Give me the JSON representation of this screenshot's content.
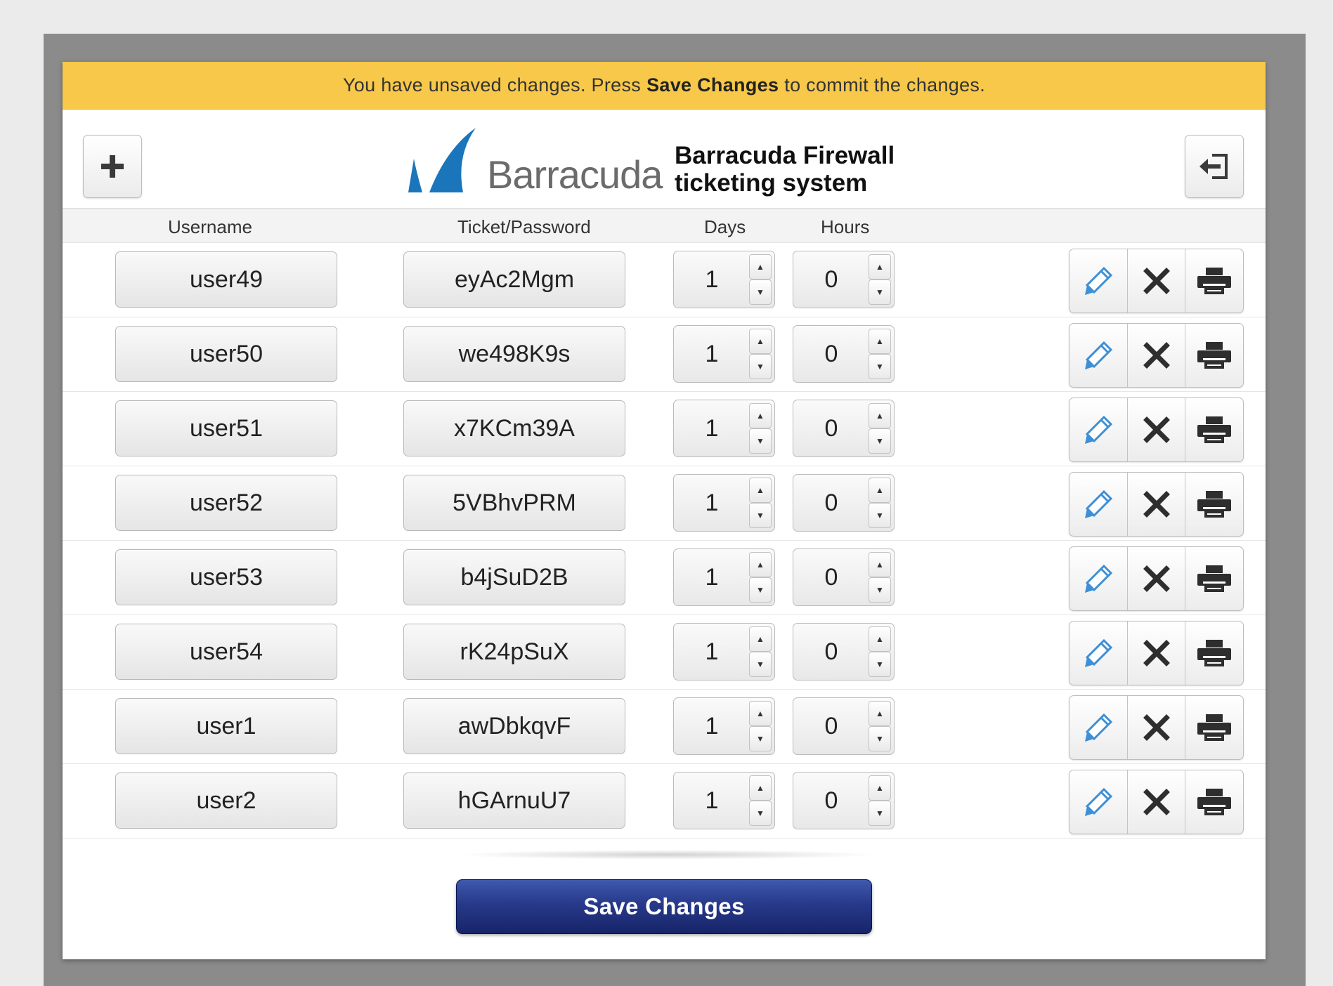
{
  "banner": {
    "prefix": "You have unsaved changes. Press",
    "emphasis": "Save Changes",
    "suffix": "to commit the changes."
  },
  "header": {
    "logo_word": "Barracuda",
    "title_line1": "Barracuda Firewall",
    "title_line2": "ticketing system",
    "add_icon": "plus-icon",
    "logout_icon": "logout-icon"
  },
  "columns": {
    "username": "Username",
    "ticket": "Ticket/Password",
    "days": "Days",
    "hours": "Hours"
  },
  "rows": [
    {
      "username": "user49",
      "ticket": "eyAc2Mgm",
      "days": "1",
      "hours": "0"
    },
    {
      "username": "user50",
      "ticket": "we498K9s",
      "days": "1",
      "hours": "0"
    },
    {
      "username": "user51",
      "ticket": "x7KCm39A",
      "days": "1",
      "hours": "0"
    },
    {
      "username": "user52",
      "ticket": "5VBhvPRM",
      "days": "1",
      "hours": "0"
    },
    {
      "username": "user53",
      "ticket": "b4jSuD2B",
      "days": "1",
      "hours": "0"
    },
    {
      "username": "user54",
      "ticket": "rK24pSuX",
      "days": "1",
      "hours": "0"
    },
    {
      "username": "user1",
      "ticket": "awDbkqvF",
      "days": "1",
      "hours": "0"
    },
    {
      "username": "user2",
      "ticket": "hGArnuU7",
      "days": "1",
      "hours": "0"
    }
  ],
  "row_actions": {
    "edit_icon": "pencil-icon",
    "delete_icon": "close-icon",
    "print_icon": "printer-icon"
  },
  "footer": {
    "save_label": "Save Changes"
  },
  "colors": {
    "banner": "#f7c849",
    "save_button": "#27398a",
    "logo_blue": "#1a75bb",
    "edit_icon": "#3d8fd6"
  }
}
